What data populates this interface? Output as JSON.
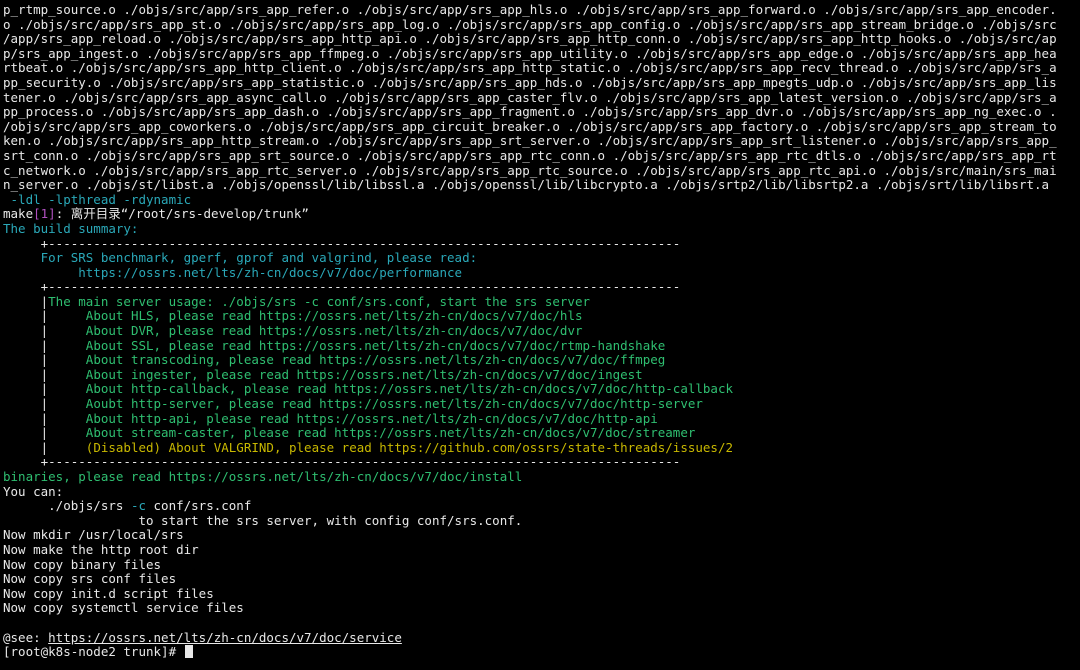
{
  "colors": {
    "background": "#000000",
    "default": "#e8e8e8",
    "cyan": "#2aa8b8",
    "green": "#2fbf71",
    "yellow": "#c8b800",
    "magenta": "#b050c0"
  },
  "terminal": {
    "lines": [
      [
        {
          "t": "p_rtmp_source.o ./objs/src/app/srs_app_refer.o ./objs/src/app/srs_app_hls.o ./objs/src/app/srs_app_forward.o ./objs/src/app/srs_app_encoder."
        }
      ],
      [
        {
          "t": "o ./objs/src/app/srs_app_st.o ./objs/src/app/srs_app_log.o ./objs/src/app/srs_app_config.o ./objs/src/app/srs_app_stream_bridge.o ./objs/src"
        }
      ],
      [
        {
          "t": "/app/srs_app_reload.o ./objs/src/app/srs_app_http_api.o ./objs/src/app/srs_app_http_conn.o ./objs/src/app/srs_app_http_hooks.o ./objs/src/ap"
        }
      ],
      [
        {
          "t": "p/srs_app_ingest.o ./objs/src/app/srs_app_ffmpeg.o ./objs/src/app/srs_app_utility.o ./objs/src/app/srs_app_edge.o ./objs/src/app/srs_app_hea"
        }
      ],
      [
        {
          "t": "rtbeat.o ./objs/src/app/srs_app_http_client.o ./objs/src/app/srs_app_http_static.o ./objs/src/app/srs_app_recv_thread.o ./objs/src/app/srs_a"
        }
      ],
      [
        {
          "t": "pp_security.o ./objs/src/app/srs_app_statistic.o ./objs/src/app/srs_app_hds.o ./objs/src/app/srs_app_mpegts_udp.o ./objs/src/app/srs_app_lis"
        }
      ],
      [
        {
          "t": "tener.o ./objs/src/app/srs_app_async_call.o ./objs/src/app/srs_app_caster_flv.o ./objs/src/app/srs_app_latest_version.o ./objs/src/app/srs_a"
        }
      ],
      [
        {
          "t": "pp_process.o ./objs/src/app/srs_app_dash.o ./objs/src/app/srs_app_fragment.o ./objs/src/app/srs_app_dvr.o ./objs/src/app/srs_app_ng_exec.o ."
        }
      ],
      [
        {
          "t": "/objs/src/app/srs_app_coworkers.o ./objs/src/app/srs_app_circuit_breaker.o ./objs/src/app/srs_app_factory.o ./objs/src/app/srs_app_stream_to"
        }
      ],
      [
        {
          "t": "ken.o ./objs/src/app/srs_app_http_stream.o ./objs/src/app/srs_app_srt_server.o ./objs/src/app/srs_app_srt_listener.o ./objs/src/app/srs_app_"
        }
      ],
      [
        {
          "t": "srt_conn.o ./objs/src/app/srs_app_srt_source.o ./objs/src/app/srs_app_rtc_conn.o ./objs/src/app/srs_app_rtc_dtls.o ./objs/src/app/srs_app_rt"
        }
      ],
      [
        {
          "t": "c_network.o ./objs/src/app/srs_app_rtc_server.o ./objs/src/app/srs_app_rtc_source.o ./objs/src/app/srs_app_rtc_api.o ./objs/src/main/srs_mai"
        }
      ],
      [
        {
          "t": "n_server.o ./objs/st/libst.a ./objs/openssl/lib/libssl.a ./objs/openssl/lib/libcrypto.a ./objs/srtp2/lib/libsrtp2.a ./objs/srt/lib/libsrt.a"
        }
      ],
      [
        {
          "t": " -ldl -lpthread -rdynamic",
          "c": "cyan"
        }
      ],
      [
        {
          "t": "make"
        },
        {
          "t": "[1]",
          "c": "magenta"
        },
        {
          "t": ": 离开目录“/root/srs-develop/trunk”"
        }
      ],
      [
        {
          "t": "The build summary:",
          "c": "cyan"
        }
      ],
      [
        {
          "t": "     +------------------------------------------------------------------------------------"
        }
      ],
      [
        {
          "t": "     For SRS benchmark, gperf, gprof and valgrind, please read:",
          "c": "cyan"
        }
      ],
      [
        {
          "t": "          https://ossrs.net/lts/zh-cn/docs/v7/doc/performance",
          "c": "cyan"
        }
      ],
      [
        {
          "t": "     +------------------------------------------------------------------------------------"
        }
      ],
      [
        {
          "t": "     |"
        },
        {
          "t": "The main server usage: ./objs/srs -c conf/srs.conf, start the srs server",
          "c": "green"
        }
      ],
      [
        {
          "t": "     |     "
        },
        {
          "t": "About HLS, please read https://ossrs.net/lts/zh-cn/docs/v7/doc/hls",
          "c": "green"
        }
      ],
      [
        {
          "t": "     |     "
        },
        {
          "t": "About DVR, please read https://ossrs.net/lts/zh-cn/docs/v7/doc/dvr",
          "c": "green"
        }
      ],
      [
        {
          "t": "     |     "
        },
        {
          "t": "About SSL, please read https://ossrs.net/lts/zh-cn/docs/v7/doc/rtmp-handshake",
          "c": "green"
        }
      ],
      [
        {
          "t": "     |     "
        },
        {
          "t": "About transcoding, please read https://ossrs.net/lts/zh-cn/docs/v7/doc/ffmpeg",
          "c": "green"
        }
      ],
      [
        {
          "t": "     |     "
        },
        {
          "t": "About ingester, please read https://ossrs.net/lts/zh-cn/docs/v7/doc/ingest",
          "c": "green"
        }
      ],
      [
        {
          "t": "     |     "
        },
        {
          "t": "About http-callback, please read https://ossrs.net/lts/zh-cn/docs/v7/doc/http-callback",
          "c": "green"
        }
      ],
      [
        {
          "t": "     |     "
        },
        {
          "t": "Aoubt http-server, please read https://ossrs.net/lts/zh-cn/docs/v7/doc/http-server",
          "c": "green"
        }
      ],
      [
        {
          "t": "     |     "
        },
        {
          "t": "About http-api, please read https://ossrs.net/lts/zh-cn/docs/v7/doc/http-api",
          "c": "green"
        }
      ],
      [
        {
          "t": "     |     "
        },
        {
          "t": "About stream-caster, please read https://ossrs.net/lts/zh-cn/docs/v7/doc/streamer",
          "c": "green"
        }
      ],
      [
        {
          "t": "     |     "
        },
        {
          "t": "(Disabled) About VALGRIND, please read https://github.com/ossrs/state-threads/issues/2",
          "c": "yellow"
        }
      ],
      [
        {
          "t": "     +------------------------------------------------------------------------------------"
        }
      ],
      [
        {
          "t": "binaries, please read https://ossrs.net/lts/zh-cn/docs/v7/doc/install",
          "c": "green"
        }
      ],
      [
        {
          "t": "You can:"
        }
      ],
      [
        {
          "t": "      ./objs/srs "
        },
        {
          "t": "-c",
          "c": "cyan"
        },
        {
          "t": " conf/srs.conf"
        }
      ],
      [
        {
          "t": "                  to start the srs server, with config conf/srs.conf."
        }
      ],
      [
        {
          "t": "Now mkdir /usr/local/srs"
        }
      ],
      [
        {
          "t": "Now make the http root dir"
        }
      ],
      [
        {
          "t": "Now copy binary files"
        }
      ],
      [
        {
          "t": "Now copy srs conf files"
        }
      ],
      [
        {
          "t": "Now copy init.d script files"
        }
      ],
      [
        {
          "t": "Now copy systemctl service files"
        }
      ],
      [
        {
          "t": ""
        }
      ],
      [
        {
          "t": "@see: "
        },
        {
          "t": "https://ossrs.net/lts/zh-cn/docs/v7/doc/service",
          "u": true
        }
      ],
      [
        {
          "t": "[root@k8s-node2 trunk]# "
        },
        {
          "cursor": true
        }
      ]
    ]
  }
}
